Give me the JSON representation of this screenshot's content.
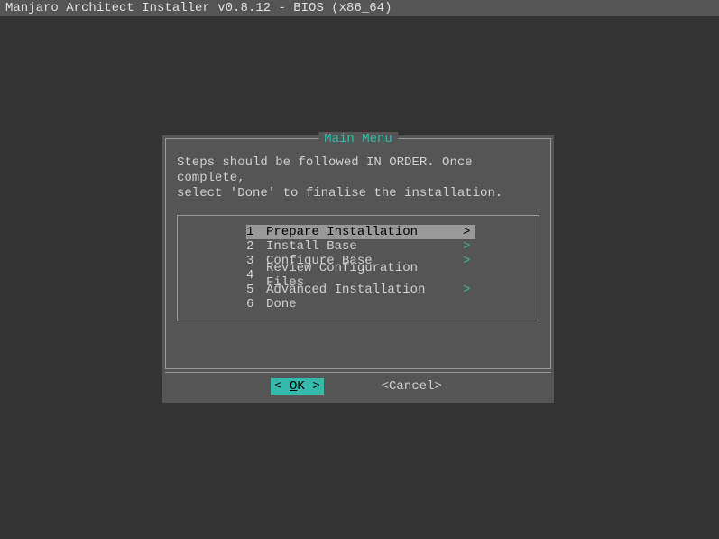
{
  "title": "Manjaro Architect Installer v0.8.12 - BIOS (x86_64)",
  "dialog": {
    "title": "Main Menu",
    "instructions": "Steps should be followed IN ORDER. Once complete,\nselect 'Done' to finalise the installation.",
    "items": [
      {
        "num": "1",
        "label": "Prepare Installation",
        "arrow": ">",
        "selected": true
      },
      {
        "num": "2",
        "label": "Install Base",
        "arrow": ">",
        "selected": false
      },
      {
        "num": "3",
        "label": "Configure Base",
        "arrow": ">",
        "selected": false
      },
      {
        "num": "4",
        "label": "Review Configuration Files",
        "arrow": "",
        "selected": false
      },
      {
        "num": "5",
        "label": "Advanced Installation",
        "arrow": ">",
        "selected": false
      },
      {
        "num": "6",
        "label": "Done",
        "arrow": "",
        "selected": false
      }
    ],
    "buttons": {
      "ok_prefix": "<  ",
      "ok_letter": "O",
      "ok_suffix": "K  >",
      "cancel": "<Cancel>"
    }
  }
}
